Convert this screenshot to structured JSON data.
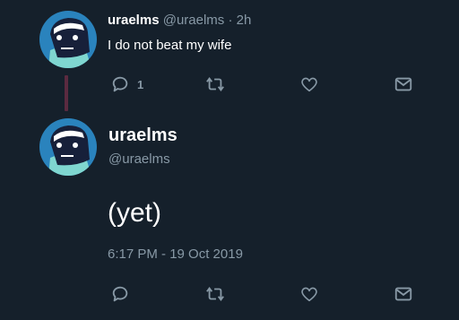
{
  "colors": {
    "background": "#15202b",
    "secondary_text": "#8899a6",
    "thread_line": "#5b2a40",
    "avatar_bg": "#2a83bd"
  },
  "tweet1": {
    "display_name": "uraelms",
    "handle": "@uraelms",
    "separator": "·",
    "time": "2h",
    "text": "I do not beat my wife",
    "reply_count": "1",
    "icons": [
      "reply-icon",
      "retweet-icon",
      "like-icon",
      "dm-icon"
    ]
  },
  "tweet2": {
    "display_name": "uraelms",
    "handle": "@uraelms",
    "text": "(yet)",
    "timestamp": "6:17 PM - 19 Oct 2019",
    "icons": [
      "reply-icon",
      "retweet-icon",
      "like-icon",
      "dm-icon"
    ]
  }
}
